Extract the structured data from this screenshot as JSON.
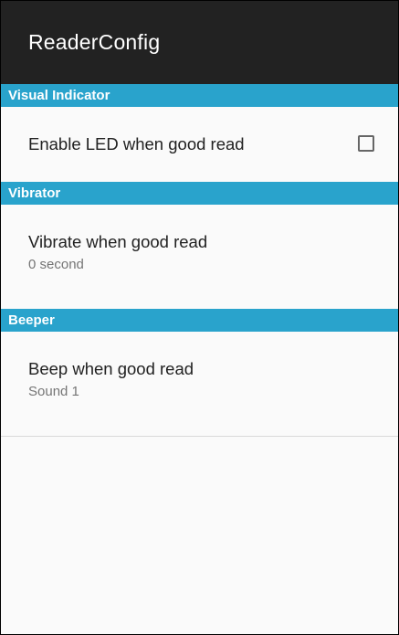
{
  "app_bar": {
    "title": "ReaderConfig"
  },
  "categories": [
    {
      "header": "Visual Indicator",
      "preference": {
        "title": "Enable LED when good read",
        "checked": false
      }
    },
    {
      "header": "Vibrator",
      "preference": {
        "title": "Vibrate when good read",
        "summary": "0 second"
      }
    },
    {
      "header": "Beeper",
      "preference": {
        "title": "Beep when good read",
        "summary": "Sound 1"
      }
    }
  ],
  "colors": {
    "app_bar_background": "#222222",
    "category_background": "#29a3cc",
    "page_background": "#fafafa"
  },
  "icons": {
    "led_checkbox": "checkbox-unchecked-icon"
  }
}
